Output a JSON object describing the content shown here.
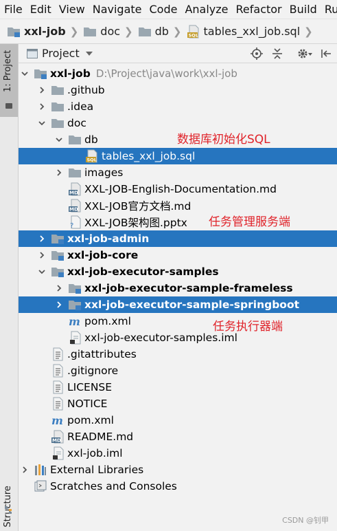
{
  "menu": [
    "File",
    "Edit",
    "View",
    "Navigate",
    "Code",
    "Analyze",
    "Refactor",
    "Build",
    "Run"
  ],
  "breadcrumb": [
    {
      "label": "xxl-job",
      "bold": true,
      "icon": "module-folder-icon"
    },
    {
      "label": "doc",
      "bold": false,
      "icon": "folder-icon"
    },
    {
      "label": "db",
      "bold": false,
      "icon": "folder-icon"
    },
    {
      "label": "tables_xxl_job.sql",
      "bold": false,
      "icon": "sql-file-icon"
    }
  ],
  "side_tabs": {
    "project": "1: Project",
    "structure": "Z: Structure"
  },
  "panel": {
    "title": "Project"
  },
  "tree": [
    {
      "indent": 0,
      "arrow": "down",
      "icon": "module-folder",
      "label": "xxl-job",
      "bold": true,
      "path": "D:\\Project\\java\\work\\xxl-job",
      "selected": false
    },
    {
      "indent": 1,
      "arrow": "right",
      "icon": "folder",
      "label": ".github",
      "bold": false,
      "selected": false
    },
    {
      "indent": 1,
      "arrow": "right",
      "icon": "folder",
      "label": ".idea",
      "bold": false,
      "selected": false
    },
    {
      "indent": 1,
      "arrow": "down",
      "icon": "folder",
      "label": "doc",
      "bold": false,
      "selected": false
    },
    {
      "indent": 2,
      "arrow": "down",
      "icon": "folder",
      "label": "db",
      "bold": false,
      "selected": false
    },
    {
      "indent": 3,
      "arrow": "none",
      "icon": "sql",
      "label": "tables_xxl_job.sql",
      "bold": false,
      "selected": true
    },
    {
      "indent": 2,
      "arrow": "right",
      "icon": "folder",
      "label": "images",
      "bold": false,
      "selected": false
    },
    {
      "indent": 2,
      "arrow": "none",
      "icon": "md",
      "label": "XXL-JOB-English-Documentation.md",
      "bold": false,
      "selected": false
    },
    {
      "indent": 2,
      "arrow": "none",
      "icon": "md",
      "label": "XXL-JOB官方文档.md",
      "bold": false,
      "selected": false
    },
    {
      "indent": 2,
      "arrow": "none",
      "icon": "unknown",
      "label": "XXL-JOB架构图.pptx",
      "bold": false,
      "selected": false
    },
    {
      "indent": 1,
      "arrow": "right",
      "icon": "module-folder",
      "label": "xxl-job-admin",
      "bold": true,
      "selected": true
    },
    {
      "indent": 1,
      "arrow": "right",
      "icon": "module-folder",
      "label": "xxl-job-core",
      "bold": true,
      "selected": false
    },
    {
      "indent": 1,
      "arrow": "down",
      "icon": "module-folder",
      "label": "xxl-job-executor-samples",
      "bold": true,
      "selected": false
    },
    {
      "indent": 2,
      "arrow": "right",
      "icon": "module-folder",
      "label": "xxl-job-executor-sample-frameless",
      "bold": true,
      "selected": false
    },
    {
      "indent": 2,
      "arrow": "right",
      "icon": "module-folder",
      "label": "xxl-job-executor-sample-springboot",
      "bold": true,
      "selected": true
    },
    {
      "indent": 2,
      "arrow": "none",
      "icon": "maven",
      "label": "pom.xml",
      "bold": false,
      "selected": false
    },
    {
      "indent": 2,
      "arrow": "none",
      "icon": "iml",
      "label": "xxl-job-executor-samples.iml",
      "bold": false,
      "selected": false
    },
    {
      "indent": 1,
      "arrow": "none",
      "icon": "text",
      "label": ".gitattributes",
      "bold": false,
      "selected": false
    },
    {
      "indent": 1,
      "arrow": "none",
      "icon": "text",
      "label": ".gitignore",
      "bold": false,
      "selected": false
    },
    {
      "indent": 1,
      "arrow": "none",
      "icon": "text",
      "label": "LICENSE",
      "bold": false,
      "selected": false
    },
    {
      "indent": 1,
      "arrow": "none",
      "icon": "text",
      "label": "NOTICE",
      "bold": false,
      "selected": false
    },
    {
      "indent": 1,
      "arrow": "none",
      "icon": "maven",
      "label": "pom.xml",
      "bold": false,
      "selected": false
    },
    {
      "indent": 1,
      "arrow": "none",
      "icon": "md",
      "label": "README.md",
      "bold": false,
      "selected": false
    },
    {
      "indent": 1,
      "arrow": "none",
      "icon": "iml",
      "label": "xxl-job.iml",
      "bold": false,
      "selected": false
    },
    {
      "indent": 0,
      "arrow": "right",
      "icon": "libraries",
      "label": "External Libraries",
      "bold": false,
      "selected": false
    },
    {
      "indent": 0,
      "arrow": "none",
      "icon": "scratches",
      "label": "Scratches and Consoles",
      "bold": false,
      "selected": false
    }
  ],
  "annotations": [
    {
      "text": "数据库初始化SQL"
    },
    {
      "text": "任务管理服务端"
    },
    {
      "text": "任务执行器端"
    }
  ],
  "watermark": "CSDN @钊甲",
  "colors": {
    "selection": "#2675bf",
    "annotation": "#e0232a",
    "folder": "#9aa7b0",
    "module_mark": "#3d7fc1"
  }
}
